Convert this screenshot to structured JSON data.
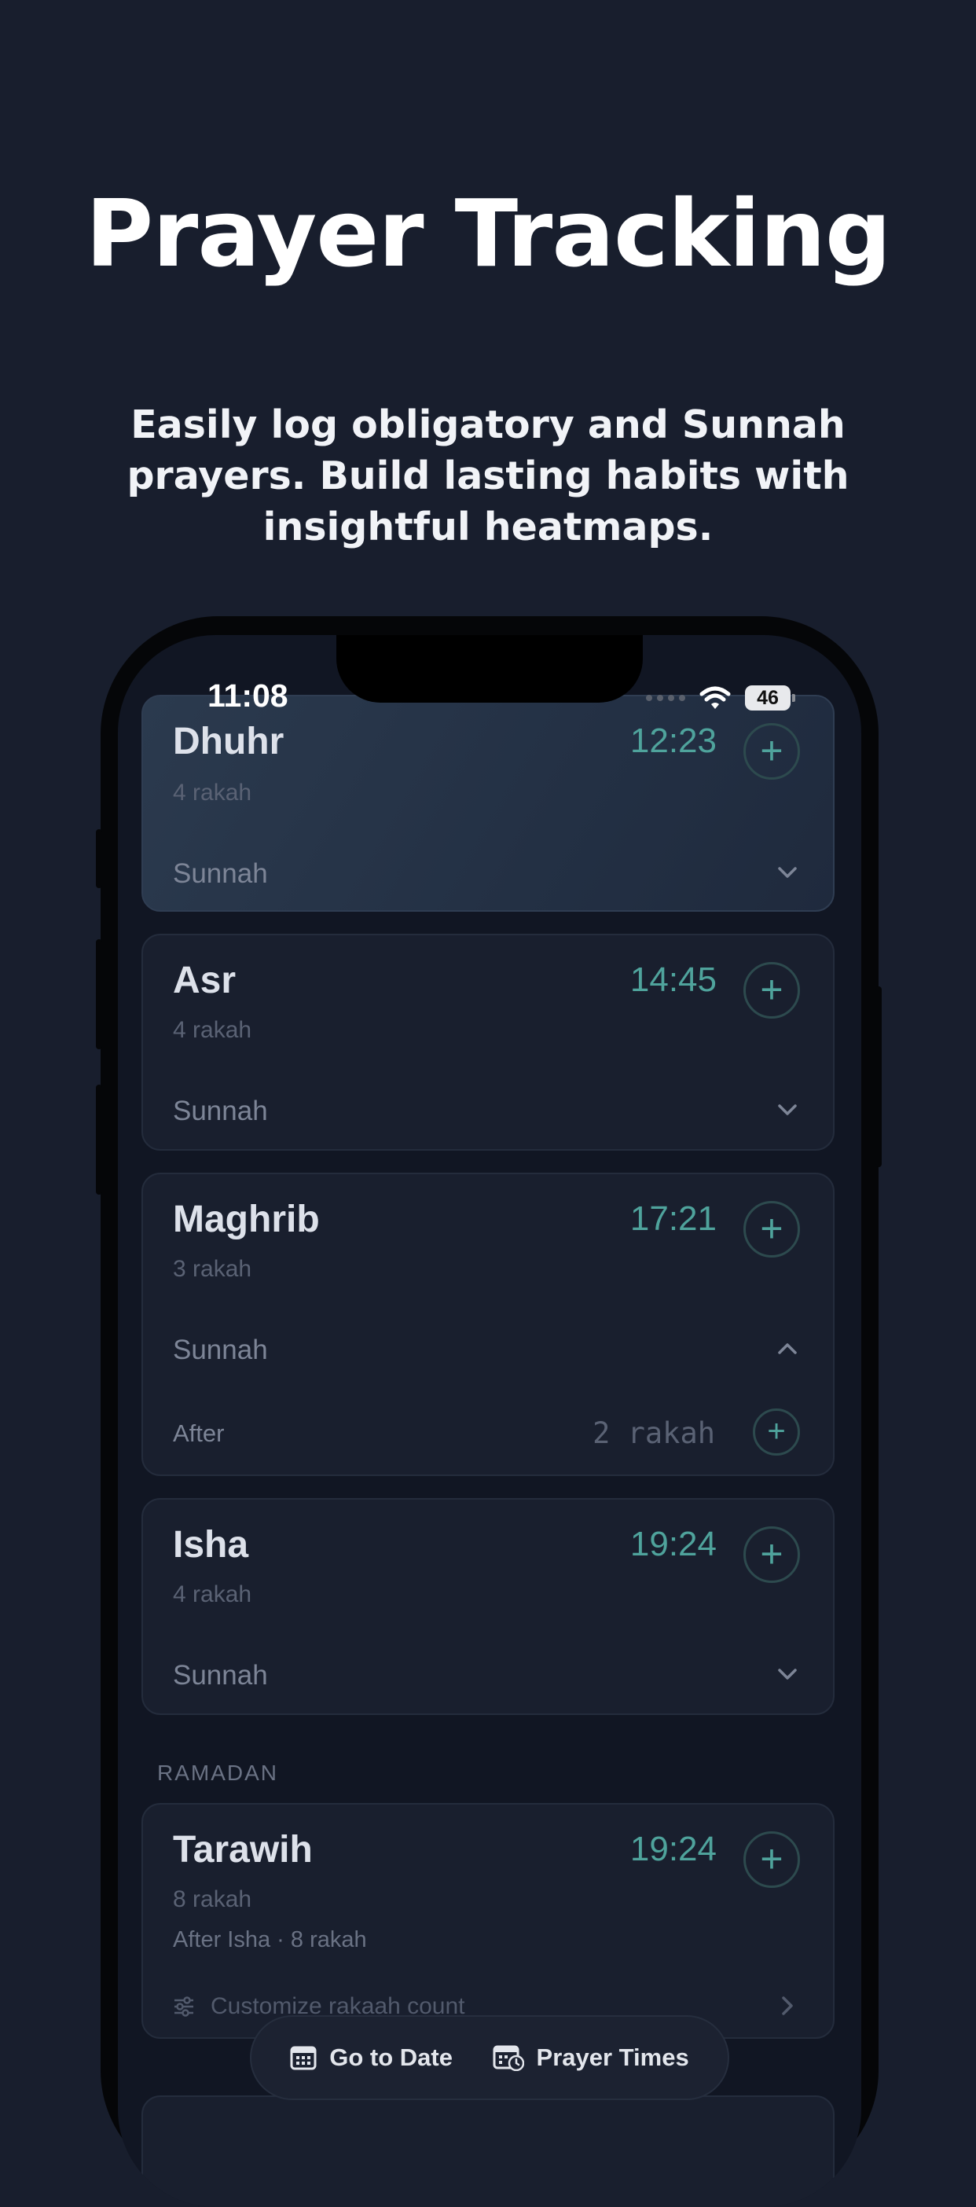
{
  "promo": {
    "title": "Prayer Tracking",
    "subtitle": "Easily log obligatory and Sunnah prayers. Build lasting habits with insightful heatmaps."
  },
  "status_bar": {
    "time": "11:08",
    "battery": "46"
  },
  "prayers": [
    {
      "name": "Dhuhr",
      "time": "12:23",
      "rakah": "4 rakah",
      "sunnah_label": "Sunnah"
    },
    {
      "name": "Asr",
      "time": "14:45",
      "rakah": "4 rakah",
      "sunnah_label": "Sunnah"
    },
    {
      "name": "Maghrib",
      "time": "17:21",
      "rakah": "3 rakah",
      "sunnah_label": "Sunnah",
      "after_label": "After",
      "after_count": "2 rakah"
    },
    {
      "name": "Isha",
      "time": "19:24",
      "rakah": "4 rakah",
      "sunnah_label": "Sunnah"
    }
  ],
  "ramadan": {
    "section_label": "RAMADAN",
    "tarawih": {
      "name": "Tarawih",
      "time": "19:24",
      "rakah": "8 rakah",
      "note": "After Isha · 8 rakah",
      "customize_label": "Customize rakaah count"
    }
  },
  "bottom_bar": {
    "go_to_date": "Go to Date",
    "prayer_times": "Prayer Times"
  },
  "colors": {
    "background": "#181e2d",
    "accent": "#4fa39c",
    "card": "#191f2e"
  }
}
